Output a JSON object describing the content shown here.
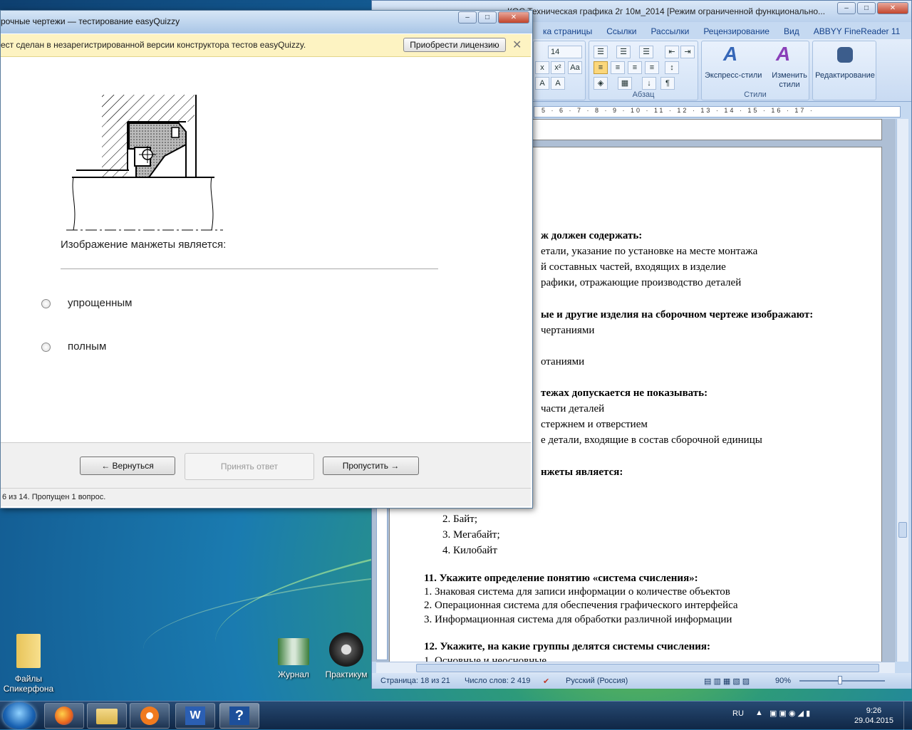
{
  "word": {
    "title": "КОС Техническая графика 2г 10м_2014 [Режим ограниченной функционально...",
    "tabs": [
      "ка страницы",
      "Ссылки",
      "Рассылки",
      "Рецензирование",
      "Вид",
      "ABBYY FineReader 11"
    ],
    "font_size": "14",
    "groups": {
      "paragraph": "Абзац",
      "styles": "Стили"
    },
    "express_styles": "Экспресс-стили",
    "change_styles": "Изменить стили",
    "editing": "Редактирование",
    "ruler": "5 · 6 · 7 · 8 · 9 · 10 · 11 · 12 · 13 · 14 · 15 · 16 · 17 ·",
    "doc_lines": [
      {
        "text": "ж должен содержать:",
        "bold": true
      },
      {
        "text": "етали, указание по установке на месте монтажа",
        "bold": false
      },
      {
        "text": "й составных частей, входящих в изделие",
        "bold": false
      },
      {
        "text": "рафики, отражающие производство деталей",
        "bold": false
      },
      {
        "text": "ые и другие изделия на сборочном чертеже изображают:",
        "bold": true
      },
      {
        "text": "чертаниями",
        "bold": false
      },
      {
        "text": "отаниями",
        "bold": false
      },
      {
        "text": "тежах допускается не показывать:",
        "bold": true
      },
      {
        "text": "части деталей",
        "bold": false
      },
      {
        "text": "стержнем и отверстием",
        "bold": false
      },
      {
        "text": "е детали, входящие в состав сборочной единицы",
        "bold": false
      },
      {
        "text": "нжеты является:",
        "bold": true
      }
    ],
    "list_items": [
      "2.   Байт;",
      "3.   Мегабайт;",
      "4.   Килобайт"
    ],
    "q11": "11. Укажите определение понятию «система счисления»:",
    "q11_items": [
      "1.  Знаковая система для записи информации о количестве объектов",
      "2.  Операционная система для обеспечения графического интерфейса",
      "3.  Информационная система для обработки различной информации"
    ],
    "q12": "12. Укажите, на какие группы делятся системы счисления:",
    "q12_item": "1.   Основные и неосновные",
    "status": {
      "page": "Страница: 18 из 21",
      "words": "Число слов: 2 419",
      "lang": "Русский (Россия)",
      "zoom": "90%"
    }
  },
  "quiz": {
    "title": "рочные чертежи — тестирование easyQuizzy",
    "notice": "ест сделан в незарегистрированной версии конструктора тестов easyQuizzy.",
    "license_button": "Приобрести лицензию",
    "question": "Изображение манжеты является:",
    "options": [
      "упрощенным",
      "полным"
    ],
    "back_button": "← Вернуться",
    "accept_button": "Принять ответ",
    "skip_button": "Пропустить →",
    "status": "6 из 14. Пропущен 1 вопрос."
  },
  "desktop": {
    "icons": [
      {
        "label": "Файлы Спикерфона"
      },
      {
        "label": "Журнал"
      },
      {
        "label": "Практикум"
      }
    ]
  },
  "tray": {
    "lang": "RU",
    "time": "9:26",
    "date": "29.04.2015"
  }
}
